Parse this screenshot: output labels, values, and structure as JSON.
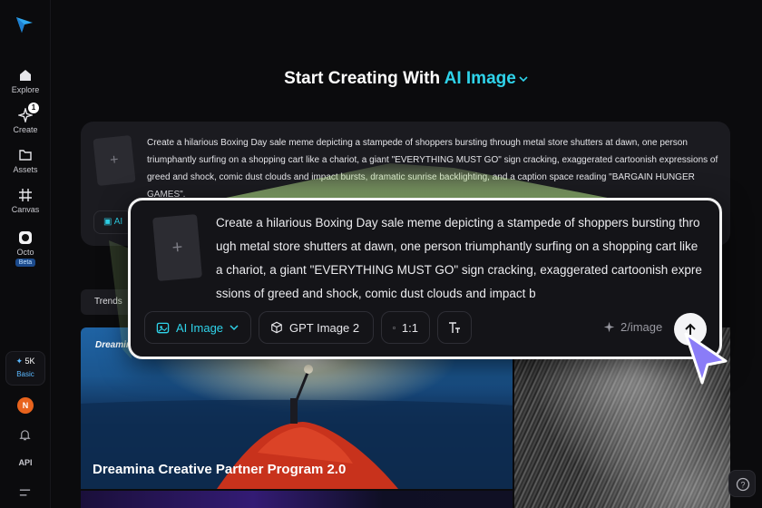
{
  "sidebar": {
    "items": [
      {
        "label": "Explore",
        "icon": "home-icon"
      },
      {
        "label": "Create",
        "icon": "create-icon",
        "badge": "1"
      },
      {
        "label": "Assets",
        "icon": "folder-icon"
      },
      {
        "label": "Canvas",
        "icon": "canvas-icon"
      },
      {
        "label": "Octo",
        "icon": "octo-icon",
        "tag": "Beta"
      }
    ],
    "credits": "5K",
    "plan": "Basic",
    "avatar_initial": "N",
    "api_label": "API"
  },
  "header": {
    "prefix": "Start Creating With",
    "accent": "AI Image"
  },
  "prompt": {
    "text": "Create a hilarious Boxing Day sale meme depicting a stampede of shoppers bursting through metal store shutters at dawn, one person triumphantly surfing on a shopping cart like a chariot, a giant \"EVERYTHING MUST GO\" sign cracking, exaggerated cartoonish expressions of greed and shock, comic dust clouds and impact bursts, dramatic sunrise backlighting, and a caption space reading \"BARGAIN HUNGER GAMES\".",
    "zoom_text": "Create a hilarious Boxing Day sale meme depicting a stampede of shoppers bursting through metal store shutters at dawn, one person triumphantly surfing on a shopping cart like a chariot, a giant \"EVERYTHING MUST GO\" sign cracking, exaggerated cartoonish expressions of greed and shock, comic dust clouds and impact b",
    "bg_chip_label": "AI"
  },
  "toolbar": {
    "mode_label": "AI Image",
    "model_label": "GPT Image 2",
    "ratio_label": "1:1",
    "cost_label": "2/image"
  },
  "feed": {
    "trends_label": "Trends",
    "logo_text": "Dreamina",
    "banner_title": "Dreamina Creative Partner Program 2.0"
  },
  "colors": {
    "accent": "#2fd3ea",
    "background": "#0b0b0d",
    "cursor": "#8a7cf7"
  }
}
